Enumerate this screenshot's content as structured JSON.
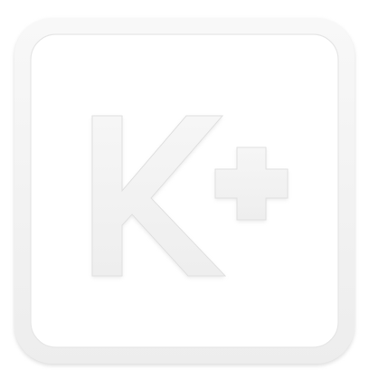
{
  "logo": {
    "text": "K+",
    "colors": {
      "background": "#ffffff",
      "frame_fill": "#f4f4f4",
      "frame_shadow": "#e2e2e2",
      "inner_panel": "#ffffff",
      "glyph_fill": "#f3f3f3",
      "glyph_edge": "#dedede"
    },
    "icon": "k-plus-logo-icon"
  }
}
